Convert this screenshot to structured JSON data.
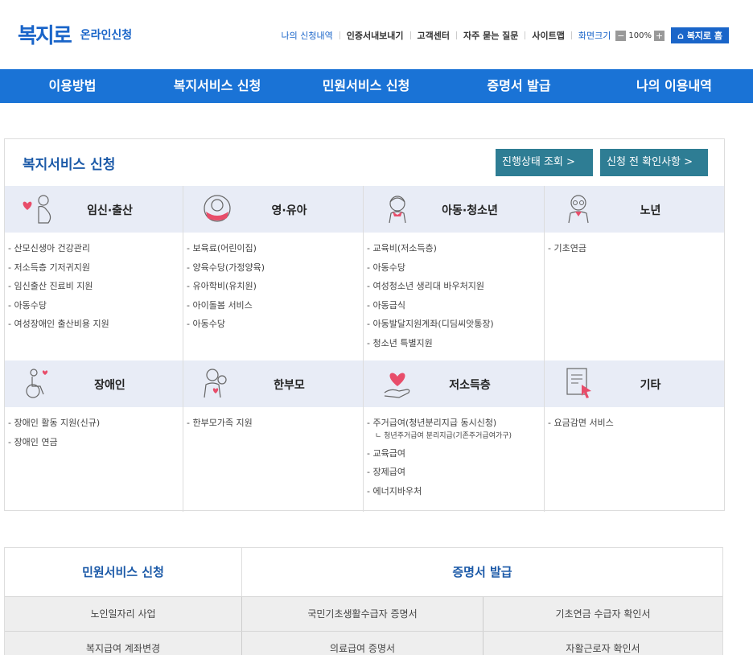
{
  "header": {
    "logo_text": "복지로",
    "logo_sub": "온라인신청",
    "util": {
      "my_apps": "나의 신청내역",
      "cert": "인증서내보내기",
      "support": "고객센터",
      "faq": "자주 묻는 질문",
      "sitemap": "사이트맵",
      "font_size_label": "화면크기",
      "zoom_minus": "−",
      "zoom_value": "100%",
      "zoom_plus": "+",
      "home": "⌂ 복지로 홈"
    }
  },
  "nav": {
    "items": [
      "이용방법",
      "복지서비스 신청",
      "민원서비스 신청",
      "증명서 발급",
      "나의 이용내역"
    ]
  },
  "welfare": {
    "title": "복지서비스 신청",
    "status_button": "진행상태 조회 >",
    "check_button": "신청 전 확인사항 >",
    "row1": [
      {
        "name": "임신·출산",
        "icon": "pregnancy-icon",
        "items": [
          "- 산모신생아 건강관리",
          "- 저소득층 기저귀지원",
          "- 임신출산 진료비 지원",
          "- 아동수당",
          "- 여성장애인 출산비용 지원"
        ]
      },
      {
        "name": "영·유아",
        "icon": "baby-icon",
        "items": [
          "- 보육료(어린이집)",
          "- 양육수당(가정양육)",
          "- 유아학비(유치원)",
          "- 아이돌봄 서비스",
          "- 아동수당"
        ]
      },
      {
        "name": "아동·청소년",
        "icon": "child-icon",
        "items": [
          "- 교육비(저소득층)",
          "- 아동수당",
          "- 여성청소년 생리대 바우처지원",
          "- 아동급식",
          "- 아동발달지원계좌(디딤씨앗통장)",
          "- 청소년 특별지원"
        ]
      },
      {
        "name": "노년",
        "icon": "elderly-icon",
        "items": [
          "- 기초연금"
        ]
      }
    ],
    "row2": [
      {
        "name": "장애인",
        "icon": "wheelchair-icon",
        "items": [
          "- 장애인 활동 지원(신규)",
          "- 장애인 연금"
        ]
      },
      {
        "name": "한부모",
        "icon": "single-parent-icon",
        "items": [
          "- 한부모가족 지원"
        ]
      },
      {
        "name": "저소득층",
        "icon": "heart-hand-icon",
        "items": [
          "- 주거급여(청년분리지급 동시신청)",
          "ㄴ 청년주거급여 분리지급(기존주거급여가구)",
          "- 교육급여",
          "- 장제급여",
          "- 에너지바우처"
        ]
      },
      {
        "name": "기타",
        "icon": "document-cursor-icon",
        "items": [
          "- 요금감면 서비스"
        ]
      }
    ]
  },
  "bottom": {
    "civil_title": "민원서비스 신청",
    "cert_title": "증명서 발급",
    "rows": [
      [
        "노인일자리 사업",
        "국민기초생활수급자 증명서",
        "기초연금 수급자 확인서"
      ],
      [
        "복지급여 계좌변경",
        "의료급여 증명서",
        "자활근로자 확인서"
      ]
    ]
  },
  "colors": {
    "brand_blue": "#1a65c9",
    "nav_blue": "#1a73d6",
    "teal_button": "#2e7d94",
    "category_bg": "#e8ecf6"
  }
}
